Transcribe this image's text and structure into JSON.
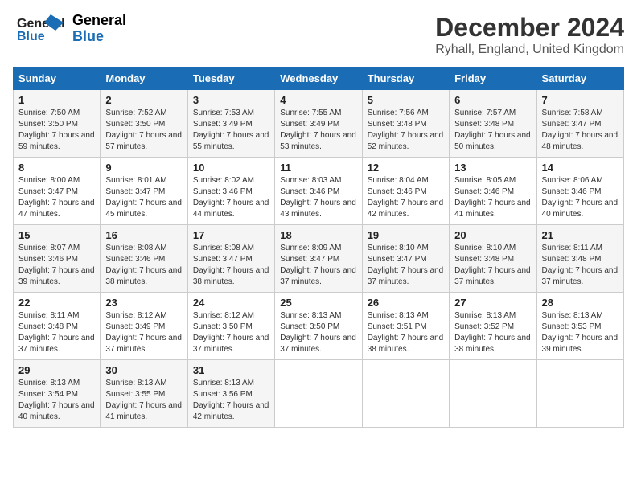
{
  "header": {
    "logo_line1": "General",
    "logo_line2": "Blue",
    "month": "December 2024",
    "location": "Ryhall, England, United Kingdom"
  },
  "weekdays": [
    "Sunday",
    "Monday",
    "Tuesday",
    "Wednesday",
    "Thursday",
    "Friday",
    "Saturday"
  ],
  "weeks": [
    [
      {
        "day": "1",
        "sunrise": "Sunrise: 7:50 AM",
        "sunset": "Sunset: 3:50 PM",
        "daylight": "Daylight: 7 hours and 59 minutes."
      },
      {
        "day": "2",
        "sunrise": "Sunrise: 7:52 AM",
        "sunset": "Sunset: 3:50 PM",
        "daylight": "Daylight: 7 hours and 57 minutes."
      },
      {
        "day": "3",
        "sunrise": "Sunrise: 7:53 AM",
        "sunset": "Sunset: 3:49 PM",
        "daylight": "Daylight: 7 hours and 55 minutes."
      },
      {
        "day": "4",
        "sunrise": "Sunrise: 7:55 AM",
        "sunset": "Sunset: 3:49 PM",
        "daylight": "Daylight: 7 hours and 53 minutes."
      },
      {
        "day": "5",
        "sunrise": "Sunrise: 7:56 AM",
        "sunset": "Sunset: 3:48 PM",
        "daylight": "Daylight: 7 hours and 52 minutes."
      },
      {
        "day": "6",
        "sunrise": "Sunrise: 7:57 AM",
        "sunset": "Sunset: 3:48 PM",
        "daylight": "Daylight: 7 hours and 50 minutes."
      },
      {
        "day": "7",
        "sunrise": "Sunrise: 7:58 AM",
        "sunset": "Sunset: 3:47 PM",
        "daylight": "Daylight: 7 hours and 48 minutes."
      }
    ],
    [
      {
        "day": "8",
        "sunrise": "Sunrise: 8:00 AM",
        "sunset": "Sunset: 3:47 PM",
        "daylight": "Daylight: 7 hours and 47 minutes."
      },
      {
        "day": "9",
        "sunrise": "Sunrise: 8:01 AM",
        "sunset": "Sunset: 3:47 PM",
        "daylight": "Daylight: 7 hours and 45 minutes."
      },
      {
        "day": "10",
        "sunrise": "Sunrise: 8:02 AM",
        "sunset": "Sunset: 3:46 PM",
        "daylight": "Daylight: 7 hours and 44 minutes."
      },
      {
        "day": "11",
        "sunrise": "Sunrise: 8:03 AM",
        "sunset": "Sunset: 3:46 PM",
        "daylight": "Daylight: 7 hours and 43 minutes."
      },
      {
        "day": "12",
        "sunrise": "Sunrise: 8:04 AM",
        "sunset": "Sunset: 3:46 PM",
        "daylight": "Daylight: 7 hours and 42 minutes."
      },
      {
        "day": "13",
        "sunrise": "Sunrise: 8:05 AM",
        "sunset": "Sunset: 3:46 PM",
        "daylight": "Daylight: 7 hours and 41 minutes."
      },
      {
        "day": "14",
        "sunrise": "Sunrise: 8:06 AM",
        "sunset": "Sunset: 3:46 PM",
        "daylight": "Daylight: 7 hours and 40 minutes."
      }
    ],
    [
      {
        "day": "15",
        "sunrise": "Sunrise: 8:07 AM",
        "sunset": "Sunset: 3:46 PM",
        "daylight": "Daylight: 7 hours and 39 minutes."
      },
      {
        "day": "16",
        "sunrise": "Sunrise: 8:08 AM",
        "sunset": "Sunset: 3:46 PM",
        "daylight": "Daylight: 7 hours and 38 minutes."
      },
      {
        "day": "17",
        "sunrise": "Sunrise: 8:08 AM",
        "sunset": "Sunset: 3:47 PM",
        "daylight": "Daylight: 7 hours and 38 minutes."
      },
      {
        "day": "18",
        "sunrise": "Sunrise: 8:09 AM",
        "sunset": "Sunset: 3:47 PM",
        "daylight": "Daylight: 7 hours and 37 minutes."
      },
      {
        "day": "19",
        "sunrise": "Sunrise: 8:10 AM",
        "sunset": "Sunset: 3:47 PM",
        "daylight": "Daylight: 7 hours and 37 minutes."
      },
      {
        "day": "20",
        "sunrise": "Sunrise: 8:10 AM",
        "sunset": "Sunset: 3:48 PM",
        "daylight": "Daylight: 7 hours and 37 minutes."
      },
      {
        "day": "21",
        "sunrise": "Sunrise: 8:11 AM",
        "sunset": "Sunset: 3:48 PM",
        "daylight": "Daylight: 7 hours and 37 minutes."
      }
    ],
    [
      {
        "day": "22",
        "sunrise": "Sunrise: 8:11 AM",
        "sunset": "Sunset: 3:48 PM",
        "daylight": "Daylight: 7 hours and 37 minutes."
      },
      {
        "day": "23",
        "sunrise": "Sunrise: 8:12 AM",
        "sunset": "Sunset: 3:49 PM",
        "daylight": "Daylight: 7 hours and 37 minutes."
      },
      {
        "day": "24",
        "sunrise": "Sunrise: 8:12 AM",
        "sunset": "Sunset: 3:50 PM",
        "daylight": "Daylight: 7 hours and 37 minutes."
      },
      {
        "day": "25",
        "sunrise": "Sunrise: 8:13 AM",
        "sunset": "Sunset: 3:50 PM",
        "daylight": "Daylight: 7 hours and 37 minutes."
      },
      {
        "day": "26",
        "sunrise": "Sunrise: 8:13 AM",
        "sunset": "Sunset: 3:51 PM",
        "daylight": "Daylight: 7 hours and 38 minutes."
      },
      {
        "day": "27",
        "sunrise": "Sunrise: 8:13 AM",
        "sunset": "Sunset: 3:52 PM",
        "daylight": "Daylight: 7 hours and 38 minutes."
      },
      {
        "day": "28",
        "sunrise": "Sunrise: 8:13 AM",
        "sunset": "Sunset: 3:53 PM",
        "daylight": "Daylight: 7 hours and 39 minutes."
      }
    ],
    [
      {
        "day": "29",
        "sunrise": "Sunrise: 8:13 AM",
        "sunset": "Sunset: 3:54 PM",
        "daylight": "Daylight: 7 hours and 40 minutes."
      },
      {
        "day": "30",
        "sunrise": "Sunrise: 8:13 AM",
        "sunset": "Sunset: 3:55 PM",
        "daylight": "Daylight: 7 hours and 41 minutes."
      },
      {
        "day": "31",
        "sunrise": "Sunrise: 8:13 AM",
        "sunset": "Sunset: 3:56 PM",
        "daylight": "Daylight: 7 hours and 42 minutes."
      },
      null,
      null,
      null,
      null
    ]
  ]
}
